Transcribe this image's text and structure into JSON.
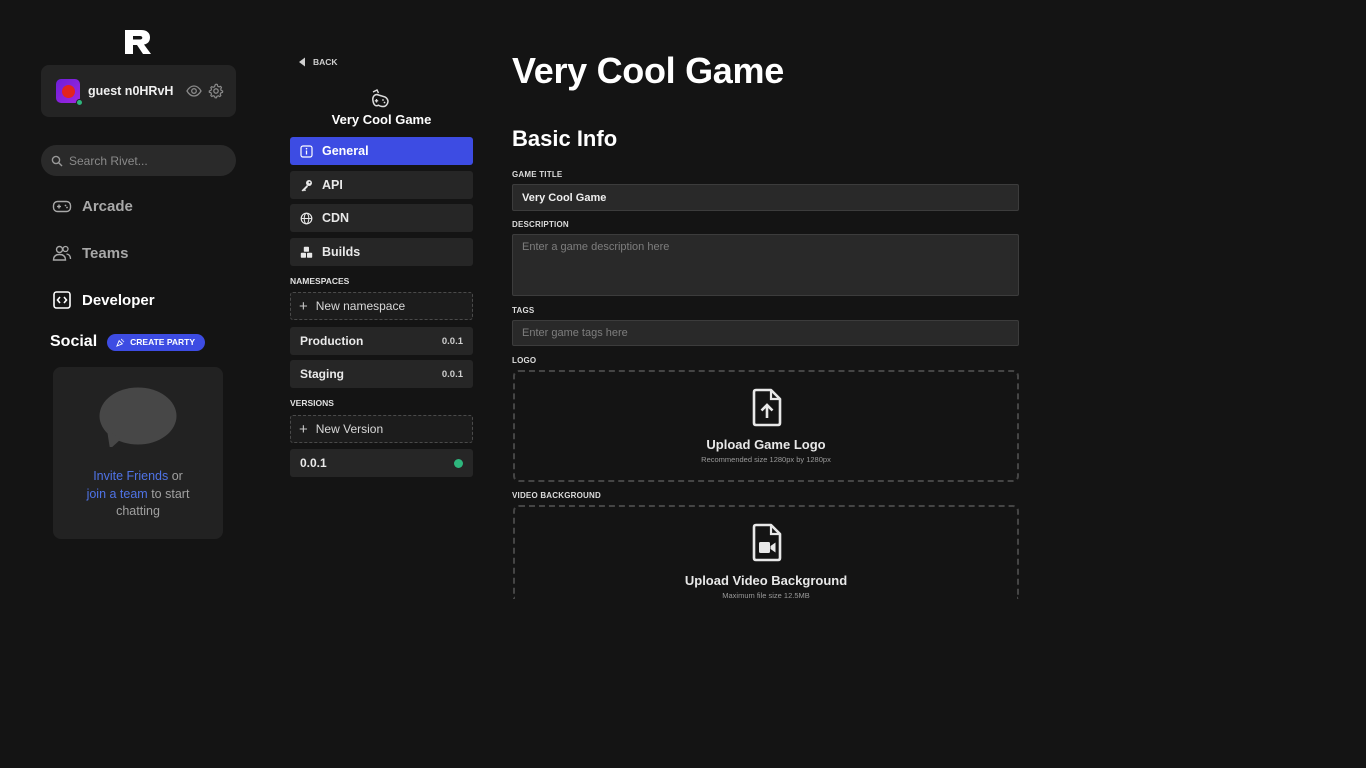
{
  "sidebar": {
    "user": {
      "name": "guest n0HRvH..."
    },
    "search": {
      "placeholder": "Search Rivet..."
    },
    "nav": [
      {
        "label": "Arcade",
        "icon": "gamepad-icon"
      },
      {
        "label": "Teams",
        "icon": "users-icon"
      },
      {
        "label": "Developer",
        "icon": "code-icon"
      }
    ],
    "social": {
      "title": "Social",
      "create_party": "CREATE PARTY",
      "invite_friends": "Invite Friends",
      "or": " or",
      "join_team": "join a team",
      "rest": " to start chatting"
    }
  },
  "game_nav": {
    "back": "BACK",
    "game_name": "Very Cool Game",
    "tabs": [
      {
        "label": "General",
        "icon": "info-icon",
        "active": true
      },
      {
        "label": "API",
        "icon": "key-icon"
      },
      {
        "label": "CDN",
        "icon": "globe-icon"
      },
      {
        "label": "Builds",
        "icon": "cubes-icon"
      }
    ],
    "namespaces_label": "NAMESPACES",
    "new_namespace": "New namespace",
    "namespaces": [
      {
        "name": "Production",
        "version": "0.0.1"
      },
      {
        "name": "Staging",
        "version": "0.0.1"
      }
    ],
    "versions_label": "VERSIONS",
    "new_version": "New Version",
    "versions": [
      {
        "name": "0.0.1",
        "status_color": "#2eb67d"
      }
    ]
  },
  "main": {
    "title": "Very Cool Game",
    "section": "Basic Info",
    "game_title_label": "GAME TITLE",
    "game_title_value": "Very Cool Game",
    "description_label": "DESCRIPTION",
    "description_placeholder": "Enter a game description here",
    "tags_label": "TAGS",
    "tags_placeholder": "Enter game tags here",
    "logo_label": "LOGO",
    "logo_upload_title": "Upload Game Logo",
    "logo_upload_sub": "Recommended size 1280px by 1280px",
    "video_label": "VIDEO BACKGROUND",
    "video_upload_title": "Upload Video Background",
    "video_upload_sub": "Maximum file size 12.5MB"
  },
  "colors": {
    "accent": "#3d4ce3",
    "online": "#2eb67d",
    "link": "#4f73e6",
    "background": "#141414"
  }
}
